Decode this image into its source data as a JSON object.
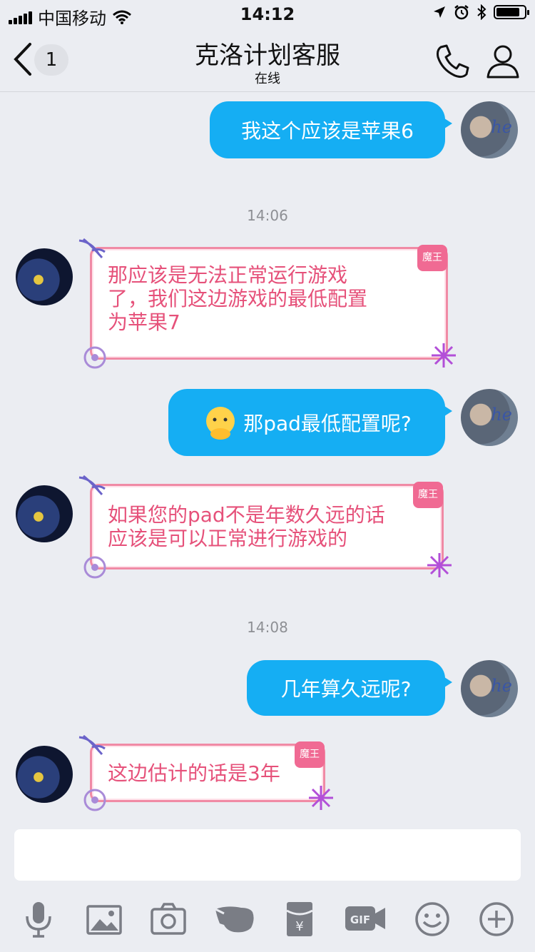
{
  "status_bar": {
    "carrier": "中国移动",
    "time": "14:12",
    "battery_level": 0.85
  },
  "nav": {
    "unread_count": "1",
    "title": "克洛计划客服",
    "subtitle": "在线"
  },
  "messages": [
    {
      "from": "me",
      "text": "我这个应该是苹果6"
    },
    {
      "timestamp": "14:06"
    },
    {
      "from": "cs",
      "tag": "魔王",
      "lines": [
        "那应该是无法正常运行游戏",
        "了，我们这边游戏的最低配置",
        "为苹果7"
      ]
    },
    {
      "from": "me",
      "text": "那pad最低配置呢?"
    },
    {
      "from": "cs",
      "tag": "魔王",
      "lines": [
        "如果您的pad不是年数久远的话",
        "应该是可以正常进行游戏的"
      ]
    },
    {
      "timestamp": "14:08"
    },
    {
      "from": "me",
      "text": "几年算久远呢?"
    },
    {
      "from": "cs",
      "tag": "魔王",
      "lines": [
        "这边估计的话是3年"
      ]
    }
  ],
  "avatar_me_text": "he",
  "input": {
    "placeholder": ""
  },
  "toolbar_icons": [
    "mic-icon",
    "image-icon",
    "camera-icon",
    "hand-icon",
    "red-packet-icon",
    "gif-icon",
    "emoji-icon",
    "plus-icon"
  ],
  "colors": {
    "my_bubble": "#15aef3",
    "cs_text": "#e6517a",
    "cs_border": "#f08aa5",
    "tag": "#f06a93"
  }
}
